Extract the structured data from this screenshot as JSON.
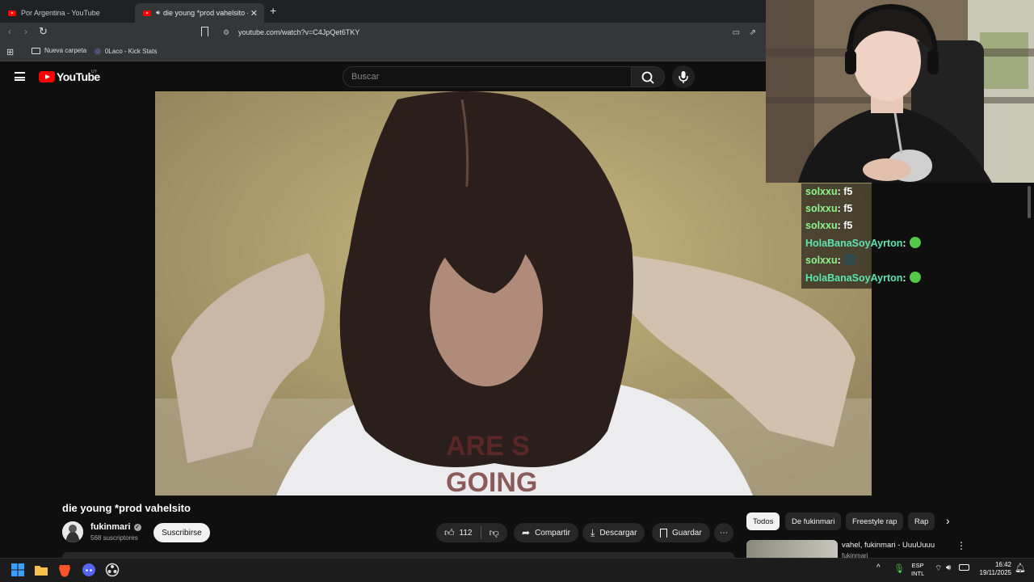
{
  "browser": {
    "tabs": [
      {
        "label": "Por Argentina - YouTube",
        "active": false
      },
      {
        "label": "die young *prod vahelsito - Y",
        "active": true,
        "playing_audio": true
      }
    ],
    "url": "youtube.com/watch?v=C4JpQet6TKY",
    "bookmarks": [
      {
        "label": "Nueva carpeta",
        "icon": "folder-icon"
      },
      {
        "label": "0Laco - Kick Stats",
        "icon": "kick-stats-icon"
      }
    ]
  },
  "youtube": {
    "logo_text": "YouTube",
    "country": "UY",
    "search_placeholder": "Buscar",
    "video": {
      "title": "die young *prod vahelsito",
      "channel": "fukinmari",
      "verified": true,
      "subscribers": "568 suscriptores",
      "subscribe_label": "Suscribirse",
      "likes": "112",
      "actions": [
        "Compartir",
        "Descargar",
        "Guardar"
      ]
    },
    "chips": [
      "Todos",
      "De fukinmari",
      "Freestyle rap",
      "Rap"
    ],
    "recommended": {
      "title": "vahel, fukinmari - UuuUuuu",
      "channel": "fukinmari"
    }
  },
  "chat": [
    {
      "user": "solxxu",
      "message": "f5",
      "color": "#8ef58e"
    },
    {
      "user": "solxxu",
      "message": "f5",
      "color": "#8ef58e"
    },
    {
      "user": "solxxu",
      "message": "f5",
      "color": "#8ef58e"
    },
    {
      "user": "HolaBanaSoyAyrton",
      "message": "",
      "emote": "green-face-emote",
      "color": "#5de4b0"
    },
    {
      "user": "solxxu",
      "message": "",
      "emote": "dark-emote",
      "color": "#8ef58e"
    },
    {
      "user": "HolaBanaSoyAyrton",
      "message": "",
      "emote": "green-face-emote",
      "color": "#5de4b0"
    }
  ],
  "taskbar": {
    "language": "ESP",
    "layout": "INTL",
    "time": "16:42",
    "date": "19/11/2025"
  }
}
